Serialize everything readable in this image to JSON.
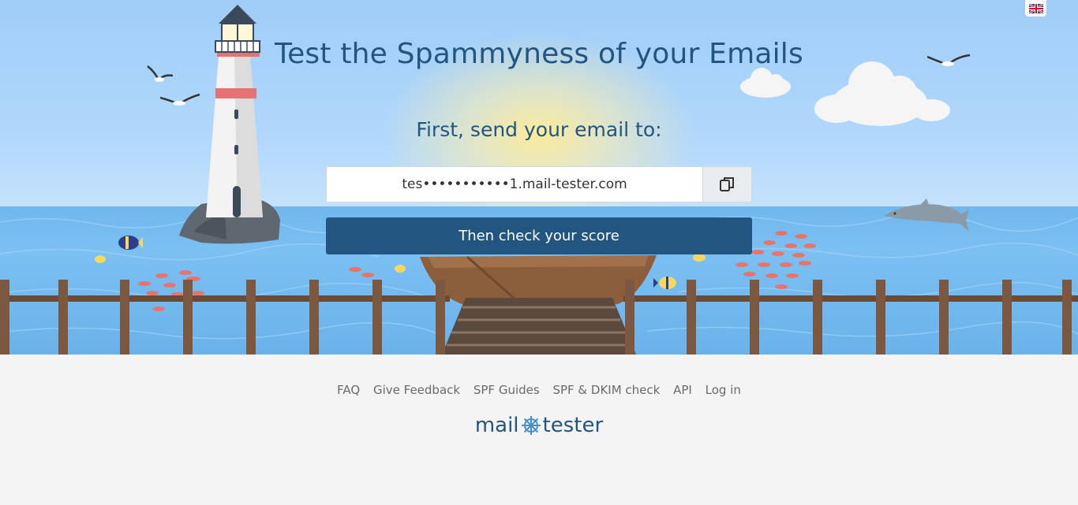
{
  "hero": {
    "title": "Test the Spammyness of your Emails",
    "subtitle": "First, send your email to:",
    "email_address": "tes•••••••••••1.mail-tester.com",
    "copy_icon": "copy-icon",
    "check_button": "Then check your score"
  },
  "language": {
    "icon": "uk-flag-icon"
  },
  "footer": {
    "links": [
      "FAQ",
      "Give Feedback",
      "SPF Guides",
      "SPF & DKIM check",
      "API",
      "Log in"
    ],
    "logo_left": "mail",
    "logo_right": "tester"
  },
  "colors": {
    "brand": "#22557f",
    "sky": "#a9d4f7",
    "sea": "#6fb7ee",
    "footer_bg": "#f4f4f4"
  }
}
